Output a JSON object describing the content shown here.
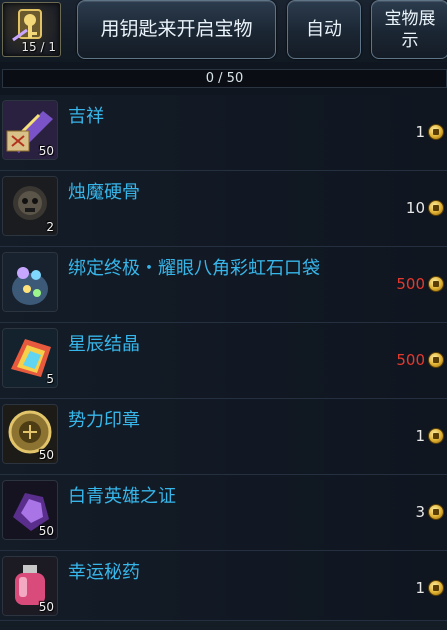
{
  "header": {
    "key_count": "15 / 1",
    "open_button": "用钥匙来开启宝物",
    "auto_button": "自动",
    "showcase_button_line1": "宝物展",
    "showcase_button_line2": "示"
  },
  "progress": {
    "text": "0 / 50",
    "value": 0,
    "max": 50
  },
  "items": [
    {
      "name": "吉祥",
      "count": "50",
      "cost": "1",
      "cost_color": "white",
      "icon": "ribbon-scroll-icon"
    },
    {
      "name": "烛魔硬骨",
      "count": "2",
      "cost": "10",
      "cost_color": "white",
      "icon": "skull-bone-icon"
    },
    {
      "name": "绑定终极・耀眼八角彩虹石口袋",
      "count": "",
      "cost": "500",
      "cost_color": "red",
      "icon": "gem-pouch-icon"
    },
    {
      "name": "星辰结晶",
      "count": "5",
      "cost": "500",
      "cost_color": "red",
      "icon": "rainbow-crystal-icon"
    },
    {
      "name": "势力印章",
      "count": "50",
      "cost": "1",
      "cost_color": "white",
      "icon": "seal-badge-icon"
    },
    {
      "name": "白青英雄之证",
      "count": "50",
      "cost": "3",
      "cost_color": "white",
      "icon": "purple-shard-icon"
    },
    {
      "name": "幸运秘药",
      "count": "50",
      "cost": "1",
      "cost_color": "white",
      "icon": "potion-jar-icon"
    }
  ]
}
